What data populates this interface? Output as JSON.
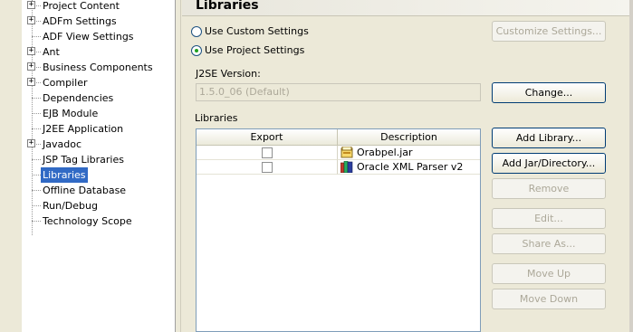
{
  "tree": {
    "items": [
      {
        "label": "Project Content",
        "expandable": true,
        "selected": false
      },
      {
        "label": "ADFm Settings",
        "expandable": true,
        "selected": false
      },
      {
        "label": "ADF View Settings",
        "expandable": false,
        "selected": false
      },
      {
        "label": "Ant",
        "expandable": true,
        "selected": false
      },
      {
        "label": "Business Components",
        "expandable": true,
        "selected": false
      },
      {
        "label": "Compiler",
        "expandable": true,
        "selected": false
      },
      {
        "label": "Dependencies",
        "expandable": false,
        "selected": false
      },
      {
        "label": "EJB Module",
        "expandable": false,
        "selected": false
      },
      {
        "label": "J2EE Application",
        "expandable": false,
        "selected": false
      },
      {
        "label": "Javadoc",
        "expandable": true,
        "selected": false
      },
      {
        "label": "JSP Tag Libraries",
        "expandable": false,
        "selected": false
      },
      {
        "label": "Libraries",
        "expandable": false,
        "selected": true
      },
      {
        "label": "Offline Database",
        "expandable": false,
        "selected": false
      },
      {
        "label": "Run/Debug",
        "expandable": false,
        "selected": false
      },
      {
        "label": "Technology Scope",
        "expandable": false,
        "selected": false
      }
    ],
    "expander_glyph": "+"
  },
  "page": {
    "title": "Libraries",
    "radio_custom": "Use Custom Settings",
    "radio_project": "Use Project Settings",
    "selected_radio": "project",
    "customize_button": "Customize Settings...",
    "j2se_label": "J2SE Version:",
    "j2se_value": "1.5.0_06 (Default)",
    "change_button": "Change...",
    "libraries_label": "Libraries"
  },
  "table": {
    "columns": [
      "Export",
      "Description"
    ],
    "rows": [
      {
        "export": false,
        "description": "Orabpel.jar",
        "icon": "jar-file-icon"
      },
      {
        "export": false,
        "description": "Oracle XML Parser v2",
        "icon": "library-books-icon"
      }
    ]
  },
  "buttons": {
    "add_library": "Add Library...",
    "add_jar": "Add Jar/Directory...",
    "remove": "Remove",
    "edit": "Edit...",
    "share_as": "Share As...",
    "move_up": "Move Up",
    "move_down": "Move Down"
  },
  "colors": {
    "selection": "#316ac5",
    "dialog_background": "#ece9d8",
    "button_border": "#003c74",
    "disabled_text": "#aca899"
  }
}
